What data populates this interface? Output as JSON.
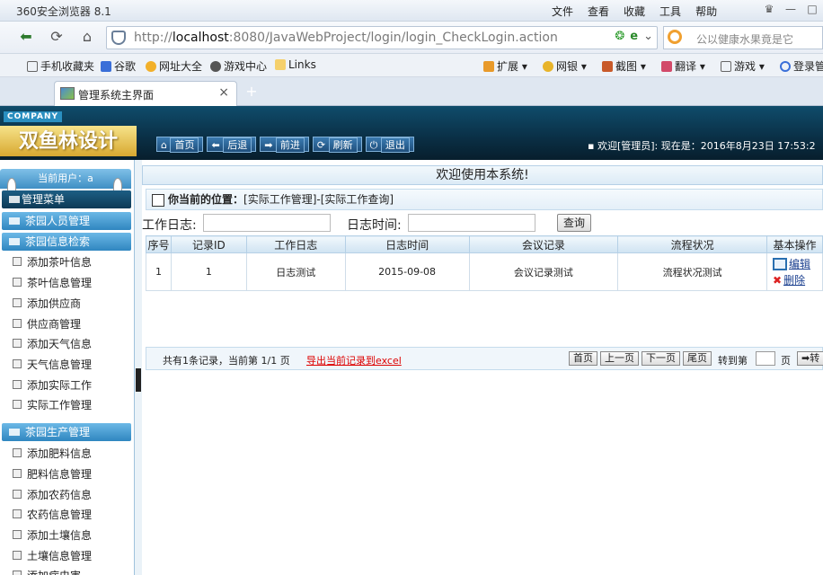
{
  "browser": {
    "app_title": "360安全浏览器 8.1",
    "menu": [
      "文件",
      "查看",
      "收藏",
      "工具",
      "帮助"
    ],
    "url_prefix": "http://",
    "url_host": "localhost",
    "url_rest": ":8080/JavaWebProject/login/login_CheckLogin.action",
    "search_placeholder": "公以健康水果竟是它",
    "favorites": [
      "手机收藏夹",
      "谷歌",
      "网址大全",
      "游戏中心",
      "Links",
      "扩展",
      "网银",
      "截图",
      "翻译",
      "游戏",
      "登录管"
    ],
    "tab_title": "管理系统主界面",
    "tab_close": "×",
    "new_tab": "+"
  },
  "header": {
    "company": "COMPANY",
    "logo": "双鱼林设计",
    "nav": [
      "首页",
      "后退",
      "前进",
      "刷新",
      "退出"
    ],
    "welcome": "欢迎[管理员]:  现在是：2016年8月23日 17:53:2"
  },
  "sidebar": {
    "current_user": "当前用户：a",
    "menu_title": "管理菜单",
    "sections": [
      {
        "title": "茶园人员管理",
        "items": []
      },
      {
        "title": "茶园信息检索",
        "items": [
          "添加茶叶信息",
          "茶叶信息管理",
          "添加供应商",
          "供应商管理",
          "添加天气信息",
          "天气信息管理",
          "添加实际工作",
          "实际工作管理"
        ]
      },
      {
        "title": "茶园生产管理",
        "items": [
          "添加肥料信息",
          "肥料信息管理",
          "添加农药信息",
          "农药信息管理",
          "添加土壤信息",
          "土壤信息管理",
          "添加病虫害"
        ]
      }
    ]
  },
  "main": {
    "system_title": "欢迎使用本系统!",
    "position_label": "你当前的位置：",
    "position_path": "[实际工作管理]-[实际工作查询]",
    "query": {
      "log_label": "工作日志:",
      "time_label": "日志时间:",
      "button": "查询"
    },
    "table": {
      "headers": [
        "序号",
        "记录ID",
        "工作日志",
        "日志时间",
        "会议记录",
        "流程状况",
        "基本操作"
      ],
      "rows": [
        {
          "no": "1",
          "id": "1",
          "log": "日志测试",
          "time": "2015-09-08",
          "meeting": "会议记录测试",
          "flow": "流程状况测试",
          "edit": "编辑",
          "delete": "删除"
        }
      ]
    },
    "pager": {
      "info": "共有1条记录，当前第 1/1 页",
      "export": "导出当前记录到excel",
      "buttons": [
        "首页",
        "上一页",
        "下一页",
        "尾页"
      ],
      "goto": "转到第",
      "page_unit": "页",
      "go": "转"
    }
  }
}
